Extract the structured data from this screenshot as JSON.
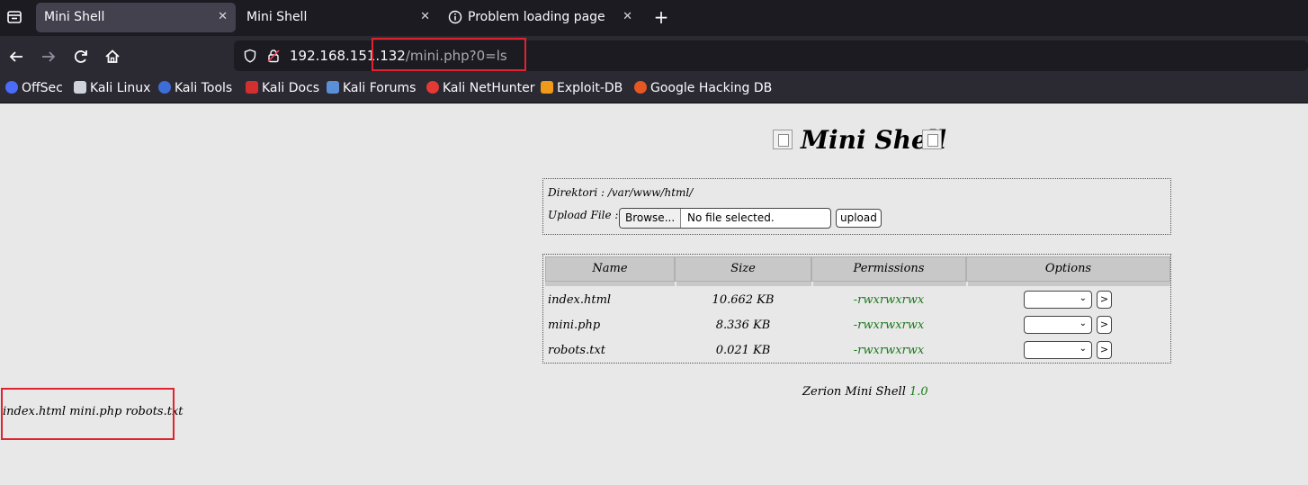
{
  "browser": {
    "tabs": [
      {
        "title": "Mini Shell",
        "active": true
      },
      {
        "title": "Mini Shell",
        "active": false
      },
      {
        "title": "Problem loading page",
        "active": false
      }
    ],
    "url": {
      "host": "192.168.151.132",
      "path": "/mini.php?0=ls"
    },
    "bookmarks": [
      {
        "label": "OffSec",
        "icon": "offsec-icon",
        "color": "#4a6cf7"
      },
      {
        "label": "Kali Linux",
        "icon": "kali-dragon-icon",
        "color": "#cfd3dc"
      },
      {
        "label": "Kali Tools",
        "icon": "kali-tools-icon",
        "color": "#3d6dd8"
      },
      {
        "label": "Kali Docs",
        "icon": "kali-docs-icon",
        "color": "#d32f2f"
      },
      {
        "label": "Kali Forums",
        "icon": "kali-forums-icon",
        "color": "#5b8fd6"
      },
      {
        "label": "Kali NetHunter",
        "icon": "kali-nethunter-icon",
        "color": "#e53935"
      },
      {
        "label": "Exploit-DB",
        "icon": "exploit-db-icon",
        "color": "#f09a1a"
      },
      {
        "label": "Google Hacking DB",
        "icon": "ghdb-icon",
        "color": "#e65722"
      }
    ]
  },
  "page": {
    "title": "Mini Shell",
    "directory_label": "Direktori : /var/www/html/",
    "upload_label": "Upload File :",
    "browse_label": "Browse...",
    "no_file_label": "No file selected.",
    "upload_button": "upload",
    "table": {
      "headers": [
        "Name",
        "Size",
        "Permissions",
        "Options"
      ],
      "rows": [
        {
          "name": "index.html",
          "size": "10.662 KB",
          "perms": "-rwxrwxrwx"
        },
        {
          "name": "mini.php",
          "size": "8.336 KB",
          "perms": "-rwxrwxrwx"
        },
        {
          "name": "robots.txt",
          "size": "0.021 KB",
          "perms": "-rwxrwxrwx"
        }
      ],
      "go_label": ">"
    },
    "footer": {
      "text": "Zerion Mini Shell",
      "version": "1.0"
    },
    "command_output": "index.html mini.php robots.txt"
  }
}
